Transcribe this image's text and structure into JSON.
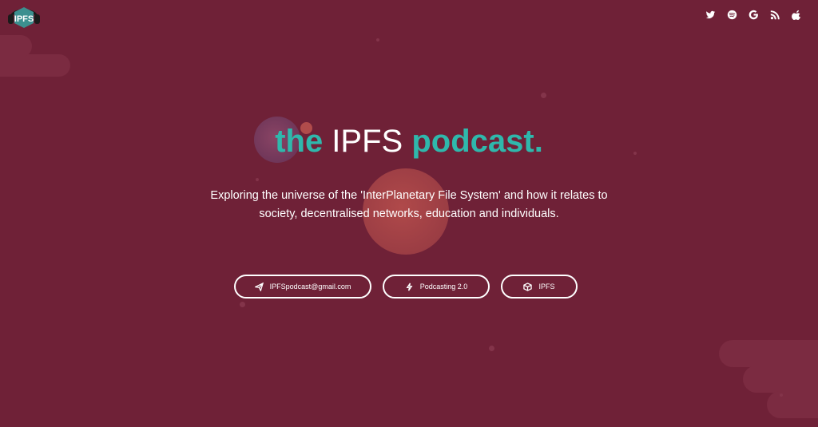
{
  "header": {
    "logo_text": "IPFS",
    "social_icons": [
      "twitter-icon",
      "spotify-icon",
      "google-icon",
      "rss-icon",
      "apple-icon"
    ]
  },
  "hero": {
    "title_part1": "the",
    "title_part2": " IPFS ",
    "title_part3": "podcast.",
    "subtitle_line1": "Exploring the universe of the 'InterPlanetary File System' and how it relates to",
    "subtitle_line2": "society, decentralised networks, education and individuals."
  },
  "buttons": [
    {
      "label": "IPFSpodcast@gmail.com",
      "icon": "paper-plane-icon"
    },
    {
      "label": "Podcasting 2.0",
      "icon": "lightning-icon"
    },
    {
      "label": "IPFS",
      "icon": "cube-icon"
    }
  ],
  "colors": {
    "background": "#6f2137",
    "accent": "#2fb8ac",
    "text": "#ffffff"
  }
}
